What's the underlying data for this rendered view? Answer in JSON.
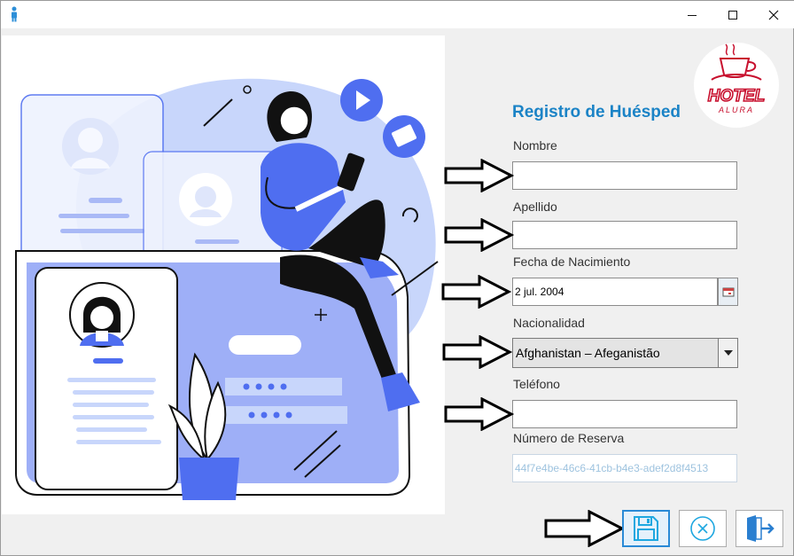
{
  "form": {
    "title": "Registro de Huésped",
    "nombre": {
      "label": "Nombre",
      "value": ""
    },
    "apellido": {
      "label": "Apellido",
      "value": ""
    },
    "fecha": {
      "label": "Fecha de Nacimiento",
      "value": "2 jul. 2004"
    },
    "nacionalidad": {
      "label": "Nacionalidad",
      "value": "Afghanistan – Afeganistão"
    },
    "telefono": {
      "label": "Teléfono",
      "value": ""
    },
    "reserva": {
      "label": "Número de Reserva",
      "value": "44f7e4be-46c6-41cb-b4e3-adef2d8f4513"
    }
  },
  "logo": {
    "text_main": "HOTEL",
    "text_sub": "ALURA"
  },
  "icons": {
    "app": "person-icon",
    "minimize": "minimize-icon",
    "maximize": "maximize-icon",
    "close": "close-icon",
    "calendar": "calendar-icon",
    "dropdown": "chevron-down-icon",
    "save": "floppy-disk-icon",
    "cancel": "cancel-circle-icon",
    "exit": "exit-door-icon"
  },
  "colors": {
    "accent": "#1b83c6",
    "illustration_blue": "#4f6ef0",
    "illustration_light": "#c8d6fb",
    "logo_red": "#c8102e"
  }
}
